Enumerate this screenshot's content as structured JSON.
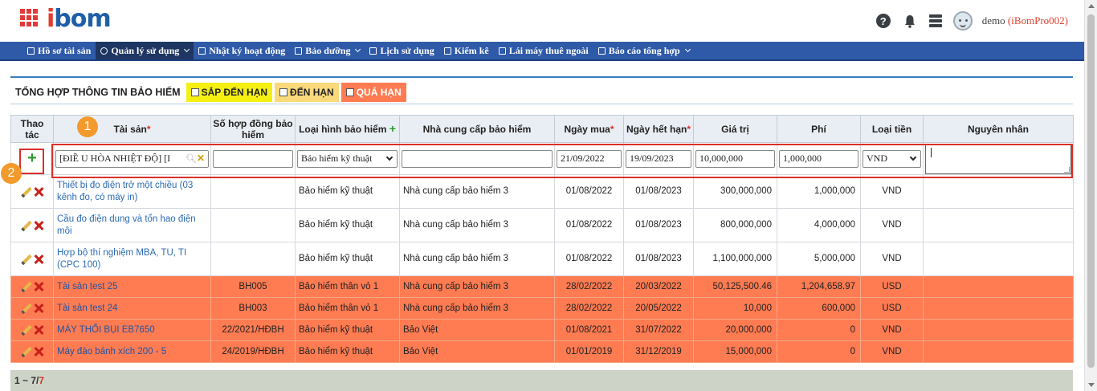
{
  "header": {
    "logo_text": "bom",
    "user_name": "demo",
    "user_account": "(iBomPro002)"
  },
  "nav": {
    "items": [
      {
        "label": "Hồ  sơ tài sản",
        "active": false,
        "dropdown": false
      },
      {
        "label": "Quản lý sử dụng",
        "active": true,
        "dropdown": true
      },
      {
        "label": "Nhật ký hoạt động",
        "active": false,
        "dropdown": false
      },
      {
        "label": "Bảo dưỡng",
        "active": false,
        "dropdown": true
      },
      {
        "label": "Lịch sử dụng",
        "active": false,
        "dropdown": false
      },
      {
        "label": "Kiểm kê",
        "active": false,
        "dropdown": false
      },
      {
        "label": "Lái máy thuê ngoài",
        "active": false,
        "dropdown": false
      },
      {
        "label": "Báo cáo tổng hợp",
        "active": false,
        "dropdown": true
      }
    ]
  },
  "filter": {
    "title": "TỔNG HỢP THÔNG TIN BẢO HIỂM",
    "tag_soon": "SẮP ĐẾN HẠN",
    "tag_due": "ĐẾN HẠN",
    "tag_over": "QUÁ HẠN"
  },
  "columns": {
    "actions": "Thao tác",
    "asset": "Tài sản",
    "contract": "Số hợp đồng bảo hiểm",
    "type": "Loại hình bảo hiểm",
    "supplier": "Nhà cung cấp bảo hiểm",
    "buy_date": "Ngày mua",
    "expire_date": "Ngày hết hạn",
    "value": "Giá trị",
    "fee": "Phí",
    "currency": "Loại tiền",
    "reason": "Nguyên nhân"
  },
  "entry": {
    "asset": "[ĐIỀ U HÒA NHIỆT ĐỘ] [I",
    "contract": "",
    "type": "Bảo hiểm kỹ thuật",
    "supplier": "",
    "buy_date": "21/09/2022",
    "expire_date": "19/09/2023",
    "value": "10,000,000",
    "fee": "1,000,000",
    "currency": "VND",
    "reason": ""
  },
  "rows": [
    {
      "asset": "Thiết bị đo điện trở một chiều (03 kênh đo, có máy in)",
      "contract": "",
      "type": "Bảo hiểm kỹ thuật",
      "supplier": "Nhà cung cấp bảo hiểm 3",
      "buy_date": "01/08/2022",
      "expire_date": "01/08/2023",
      "value": "300,000,000",
      "fee": "1,000,000",
      "currency": "VND",
      "reason": "",
      "overdue": false
    },
    {
      "asset": "Cầu đo điện dung và tổn hao điện môi",
      "contract": "",
      "type": "Bảo hiểm kỹ thuật",
      "supplier": "Nhà cung cấp bảo hiểm 3",
      "buy_date": "01/08/2022",
      "expire_date": "01/08/2023",
      "value": "800,000,000",
      "fee": "4,000,000",
      "currency": "VND",
      "reason": "",
      "overdue": false
    },
    {
      "asset": "Hợp bộ thí nghiệm MBA, TU, TI (CPC 100)",
      "contract": "",
      "type": "Bảo hiểm kỹ thuật",
      "supplier": "Nhà cung cấp bảo hiểm 3",
      "buy_date": "01/08/2022",
      "expire_date": "01/08/2023",
      "value": "1,100,000,000",
      "fee": "5,000,000",
      "currency": "VND",
      "reason": "",
      "overdue": false
    },
    {
      "asset": "Tài sản test 25",
      "contract": "BH005",
      "type": "Bảo hiểm thân vỏ 1",
      "supplier": "Nhà cung cấp bảo hiểm 3",
      "buy_date": "28/02/2022",
      "expire_date": "20/03/2022",
      "value": "50,125,500.46",
      "fee": "1,204,658.97",
      "currency": "USD",
      "reason": "",
      "overdue": true
    },
    {
      "asset": "Tài sản test 24",
      "contract": "BH003",
      "type": "Bảo hiểm thân vỏ 1",
      "supplier": "Nhà cung cấp bảo hiểm 3",
      "buy_date": "28/02/2022",
      "expire_date": "20/05/2022",
      "value": "10,000",
      "fee": "600,000",
      "currency": "USD",
      "reason": "",
      "overdue": true
    },
    {
      "asset": "MÁY THỔI BỤI EB7650",
      "contract": "22/2021/HĐBH",
      "type": "Bảo hiểm kỹ thuật",
      "supplier": "Bảo Việt",
      "buy_date": "01/08/2021",
      "expire_date": "31/07/2022",
      "value": "20,000,000",
      "fee": "0",
      "currency": "VND",
      "reason": "",
      "overdue": true
    },
    {
      "asset": "Máy đào bánh xích 200 - 5",
      "contract": "24/2019/HĐBH",
      "type": "Bảo hiểm kỹ thuật",
      "supplier": "Bảo Việt",
      "buy_date": "01/01/2019",
      "expire_date": "31/12/2019",
      "value": "15,000,000",
      "fee": "0",
      "currency": "VND",
      "reason": "",
      "overdue": true
    }
  ],
  "callouts": {
    "one": "1",
    "two": "2"
  },
  "footer": {
    "range": "1 ~ 7/ ",
    "total": "7"
  },
  "colors": {
    "nav": "#2f5aa8",
    "overdue_row": "#ff7b52",
    "soon": "#f5f012",
    "due": "#f9d97a",
    "accent_red": "#d9302a"
  }
}
